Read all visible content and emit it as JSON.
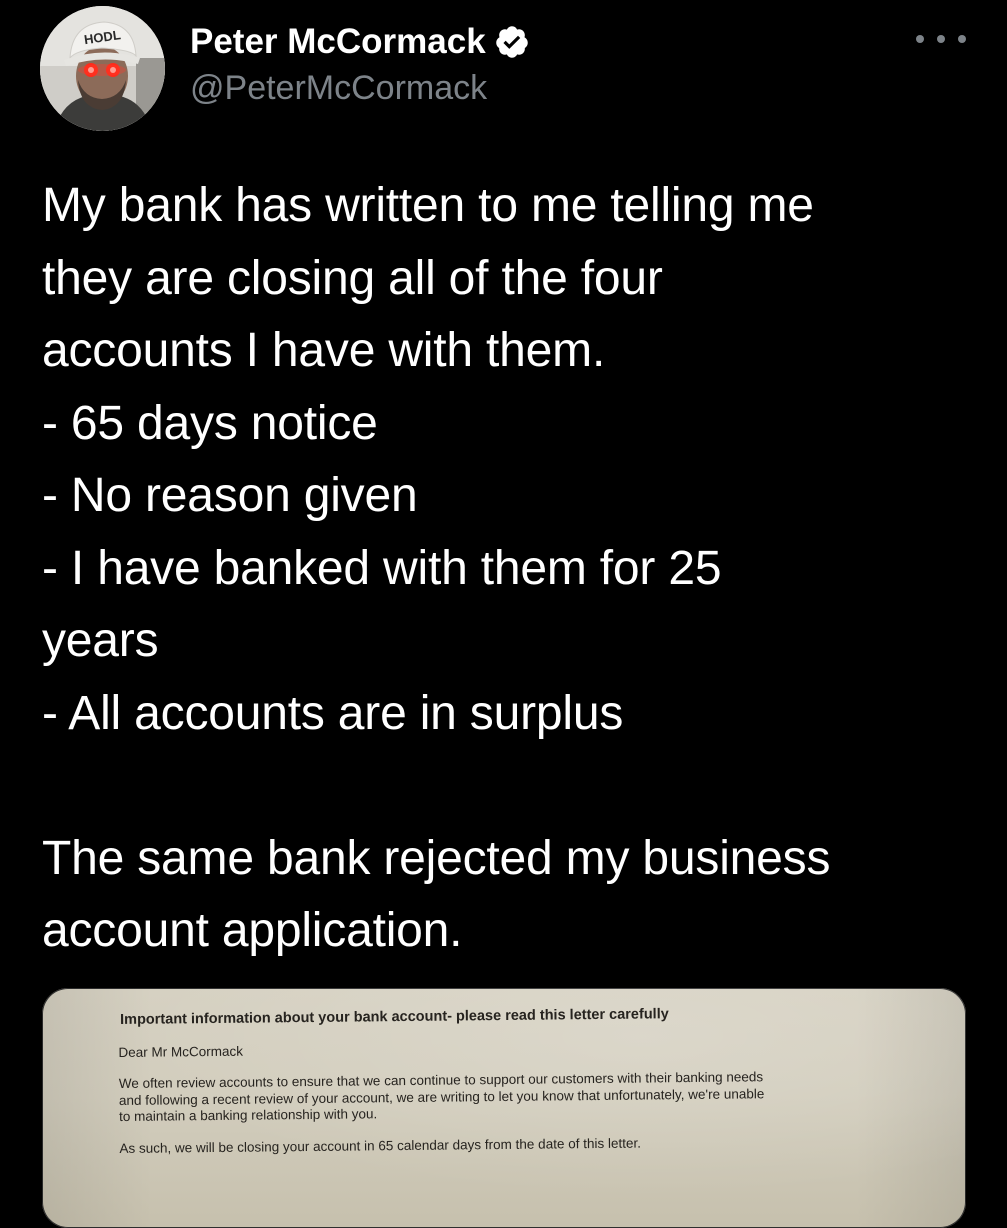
{
  "author": {
    "name": "Peter McCormack",
    "handle": "@PeterMcCormack",
    "avatar_cap_text": "HODL",
    "verified": true
  },
  "tweet": {
    "lines": [
      "My bank has written to me telling me",
      "they are closing all of the four",
      "accounts I have with them.",
      "- 65 days notice",
      "- No reason given",
      "- I have banked with them for 25",
      "years",
      "- All accounts are in surplus",
      "",
      "The same bank rejected my business",
      "account application."
    ]
  },
  "media": {
    "letter": {
      "heading": "Important information about your bank account- please read this letter carefully",
      "salutation": "Dear Mr McCormack",
      "paragraph1": [
        "We often review accounts to ensure that we can continue to support our customers with their banking needs",
        "and following a recent review of your account, we are writing to let you know that unfortunately, we're unable",
        "to maintain a banking relationship with you."
      ],
      "paragraph2": "As such, we will be closing your account in 65 calendar days from the date of this letter."
    }
  },
  "colors": {
    "background": "#000000",
    "text": "#ffffff",
    "secondary_text": "#7d8389",
    "verified_badge": "#ffffff"
  },
  "icons": {
    "verified": "verified-badge-icon",
    "more": "more-dots-icon"
  }
}
